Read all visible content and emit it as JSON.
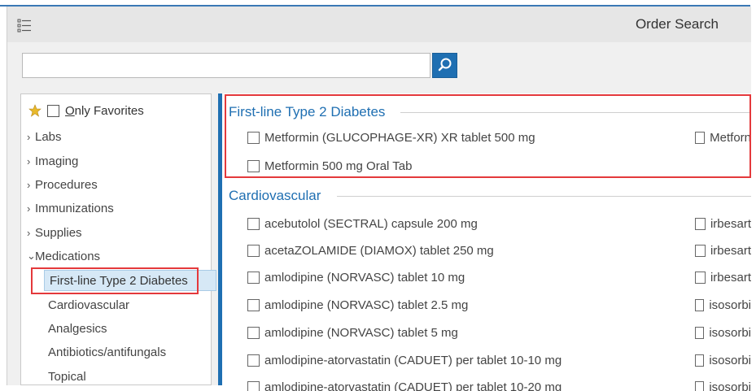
{
  "header": {
    "title": "Order Search"
  },
  "search": {
    "value": "",
    "placeholder": ""
  },
  "sidebar": {
    "favorites_label_prefix": "O",
    "favorites_label_rest": "nly Favorites",
    "items": [
      {
        "label": "Labs",
        "caret": "›"
      },
      {
        "label": "Imaging",
        "caret": "›"
      },
      {
        "label": "Procedures",
        "caret": "›"
      },
      {
        "label": "Immunizations",
        "caret": "›"
      },
      {
        "label": "Supplies",
        "caret": "›"
      },
      {
        "label": "Medications",
        "caret": "⌄"
      }
    ],
    "subitems": [
      {
        "label": "First-line Type 2 Diabetes",
        "selected": true
      },
      {
        "label": "Cardiovascular"
      },
      {
        "label": "Analgesics"
      },
      {
        "label": "Antibiotics/antifungals"
      },
      {
        "label": "Topical"
      }
    ]
  },
  "sections": [
    {
      "title": "First-line Type 2 Diabetes",
      "left": [
        "Metformin (GLUCOPHAGE-XR) XR tablet 500 mg",
        "Metformin 500 mg Oral Tab"
      ],
      "right": [
        "Metforn"
      ]
    },
    {
      "title": "Cardiovascular",
      "left": [
        "acebutolol (SECTRAL) capsule 200 mg",
        "acetaZOLAMIDE (DIAMOX) tablet 250 mg",
        "amlodipine (NORVASC) tablet 10 mg",
        "amlodipine (NORVASC) tablet 2.5 mg",
        "amlodipine (NORVASC) tablet 5 mg",
        "amlodipine-atorvastatin (CADUET) per tablet 10-10 mg",
        "amlodipine-atorvastatin (CADUET) per tablet 10-20 mg"
      ],
      "right": [
        "irbesart",
        "irbesart",
        "irbesart",
        "isosorbi",
        "isosorbi",
        "isosorbi",
        "isosorbi"
      ]
    }
  ],
  "colors": {
    "accent": "#1f6fb2",
    "highlight": "#e4393c",
    "selected_bg": "#d6e8f6"
  },
  "icons": {
    "menu": "list-menu-icon",
    "search": "magnifier-icon",
    "favorite": "star-icon"
  }
}
